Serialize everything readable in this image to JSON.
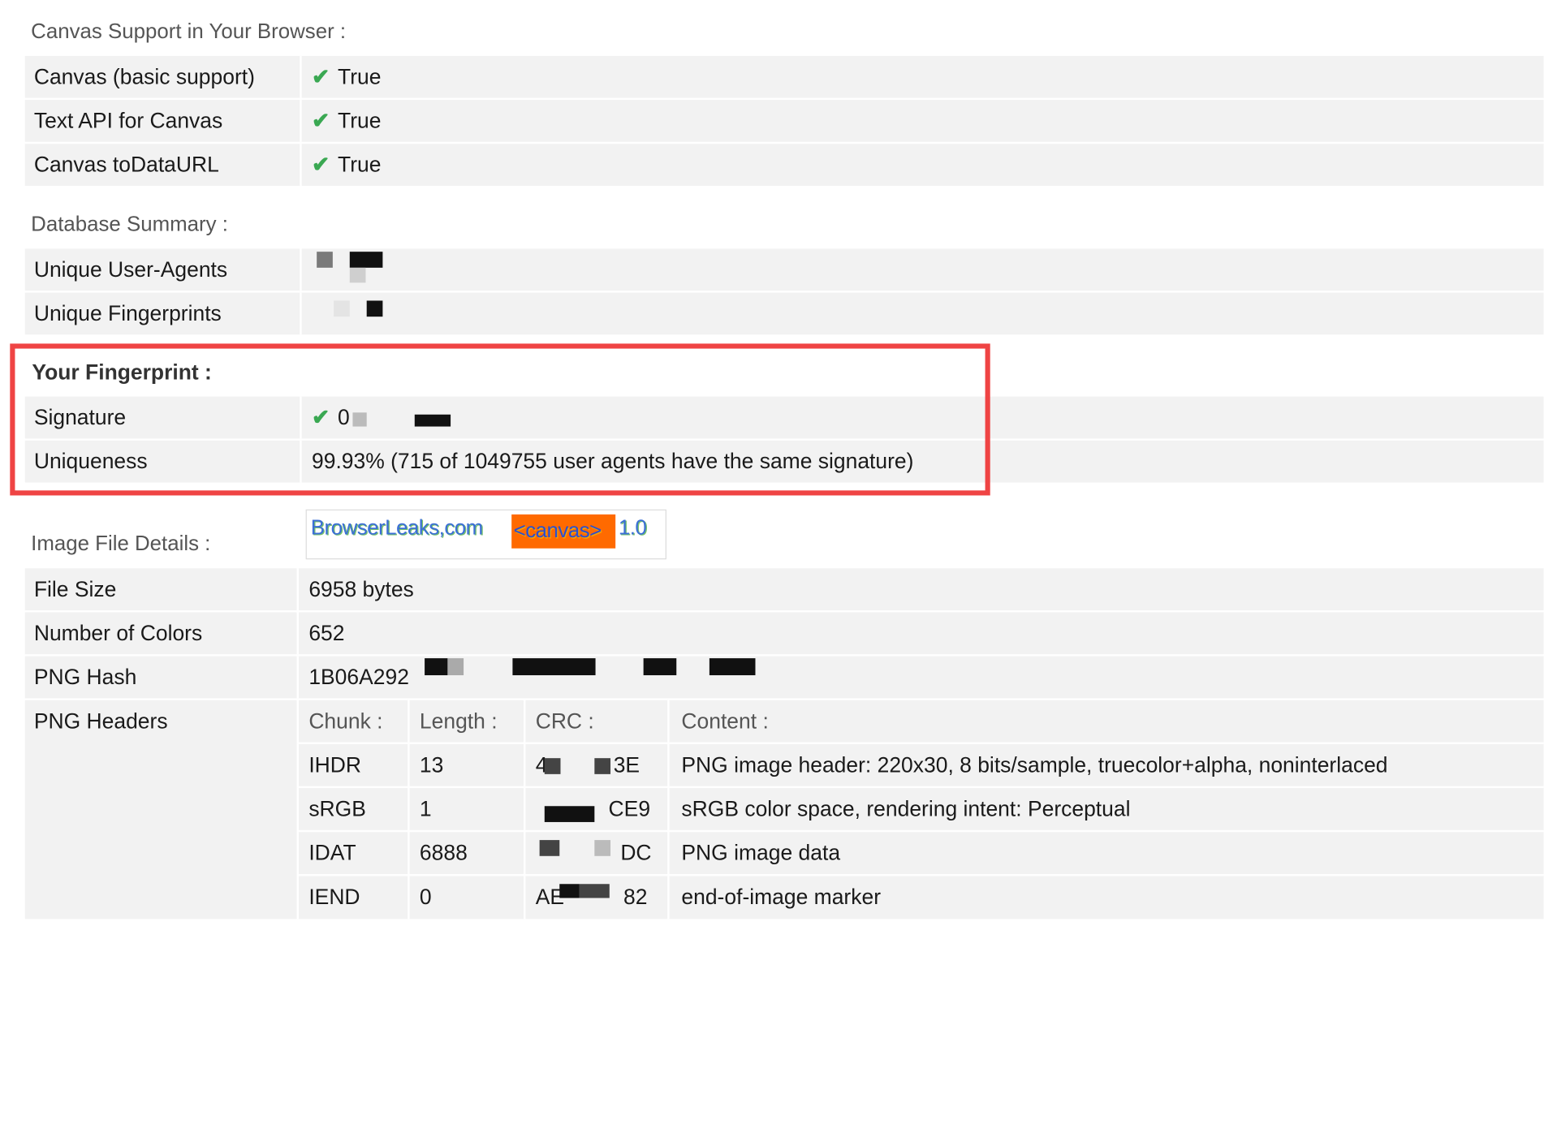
{
  "canvas_support": {
    "title": "Canvas Support in Your Browser :",
    "rows": [
      {
        "label": "Canvas (basic support)",
        "value": "True"
      },
      {
        "label": "Text API for Canvas",
        "value": "True"
      },
      {
        "label": "Canvas toDataURL",
        "value": "True"
      }
    ]
  },
  "database_summary": {
    "title": "Database Summary :",
    "rows": [
      {
        "label": "Unique User-Agents"
      },
      {
        "label": "Unique Fingerprints"
      }
    ]
  },
  "fingerprint": {
    "title": "Your Fingerprint :",
    "signature_label": "Signature",
    "signature_value_visible": "0",
    "uniqueness_label": "Uniqueness",
    "uniqueness_value": "99.93% (715 of 1049755 user agents have the same signature)"
  },
  "image_file": {
    "title": "Image File Details :",
    "canvas_image": {
      "part1": "BrowserLeaks,com",
      "part2": "<canvas>",
      "part3": "1.0"
    },
    "file_size_label": "File Size",
    "file_size_value": "6958 bytes",
    "colors_label": "Number of Colors",
    "colors_value": "652",
    "hash_label": "PNG Hash",
    "hash_value_visible": "1B06A292",
    "headers_label": "PNG Headers",
    "columns": [
      "Chunk :",
      "Length :",
      "CRC :",
      "Content :"
    ],
    "chunks": [
      {
        "chunk": "IHDR",
        "length": "13",
        "crc_visible": "4",
        "crc_end": "3E",
        "content": "PNG image header: 220x30, 8 bits/sample, truecolor+alpha, noninterlaced"
      },
      {
        "chunk": "sRGB",
        "length": "1",
        "crc_visible": "",
        "crc_end": "CE9",
        "content": "sRGB color space, rendering intent: Perceptual"
      },
      {
        "chunk": "IDAT",
        "length": "6888",
        "crc_visible": "",
        "crc_end": "DC",
        "content": "PNG image data"
      },
      {
        "chunk": "IEND",
        "length": "0",
        "crc_visible": "AE",
        "crc_end": "82",
        "content": "end-of-image marker"
      }
    ]
  },
  "colors": {
    "accent_red": "#ef4444",
    "check_green": "#3aa852",
    "row_bg": "#f2f2f2"
  }
}
